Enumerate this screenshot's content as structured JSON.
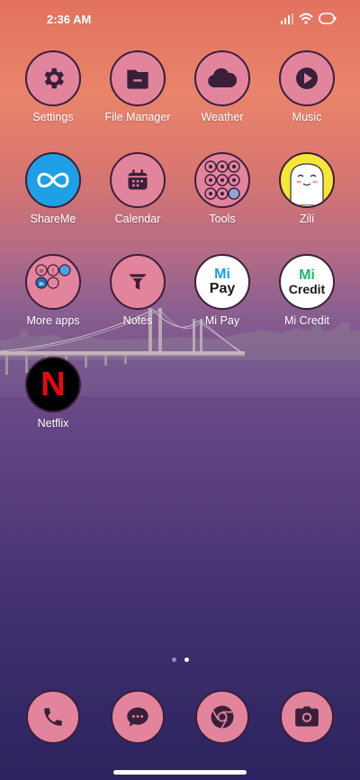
{
  "status_bar": {
    "time": "2:36 AM"
  },
  "colors": {
    "icon_bg": "#e3849d",
    "icon_glyph": "#3a1f3b",
    "icon_border": "#3a1f3b"
  },
  "apps": [
    {
      "label": "Settings",
      "icon": "gear-icon"
    },
    {
      "label": "File Manager",
      "icon": "folder-icon"
    },
    {
      "label": "Weather",
      "icon": "cloud-icon"
    },
    {
      "label": "Music",
      "icon": "play-icon"
    },
    {
      "label": "ShareMe",
      "icon": "infinity-icon"
    },
    {
      "label": "Calendar",
      "icon": "calendar-icon"
    },
    {
      "label": "Tools",
      "icon": "tools-folder-icon"
    },
    {
      "label": "Zili",
      "icon": "zili-face-icon"
    },
    {
      "label": "More apps",
      "icon": "apps-folder-icon"
    },
    {
      "label": "Notes",
      "icon": "funnel-icon"
    },
    {
      "label": "Mi Pay",
      "icon": "mi-pay-icon"
    },
    {
      "label": "Mi Credit",
      "icon": "mi-credit-icon"
    },
    {
      "label": "Netflix",
      "icon": "netflix-icon"
    }
  ],
  "logos": {
    "mi_pay": {
      "line1": "Mi",
      "line2": "Pay"
    },
    "mi_credit": {
      "line1": "Mi",
      "line2": "Credit"
    },
    "netflix": "N"
  },
  "pages": {
    "count": 2,
    "active": 2
  },
  "dock": [
    {
      "icon": "phone-icon"
    },
    {
      "icon": "messages-icon"
    },
    {
      "icon": "chrome-icon"
    },
    {
      "icon": "camera-icon"
    }
  ]
}
